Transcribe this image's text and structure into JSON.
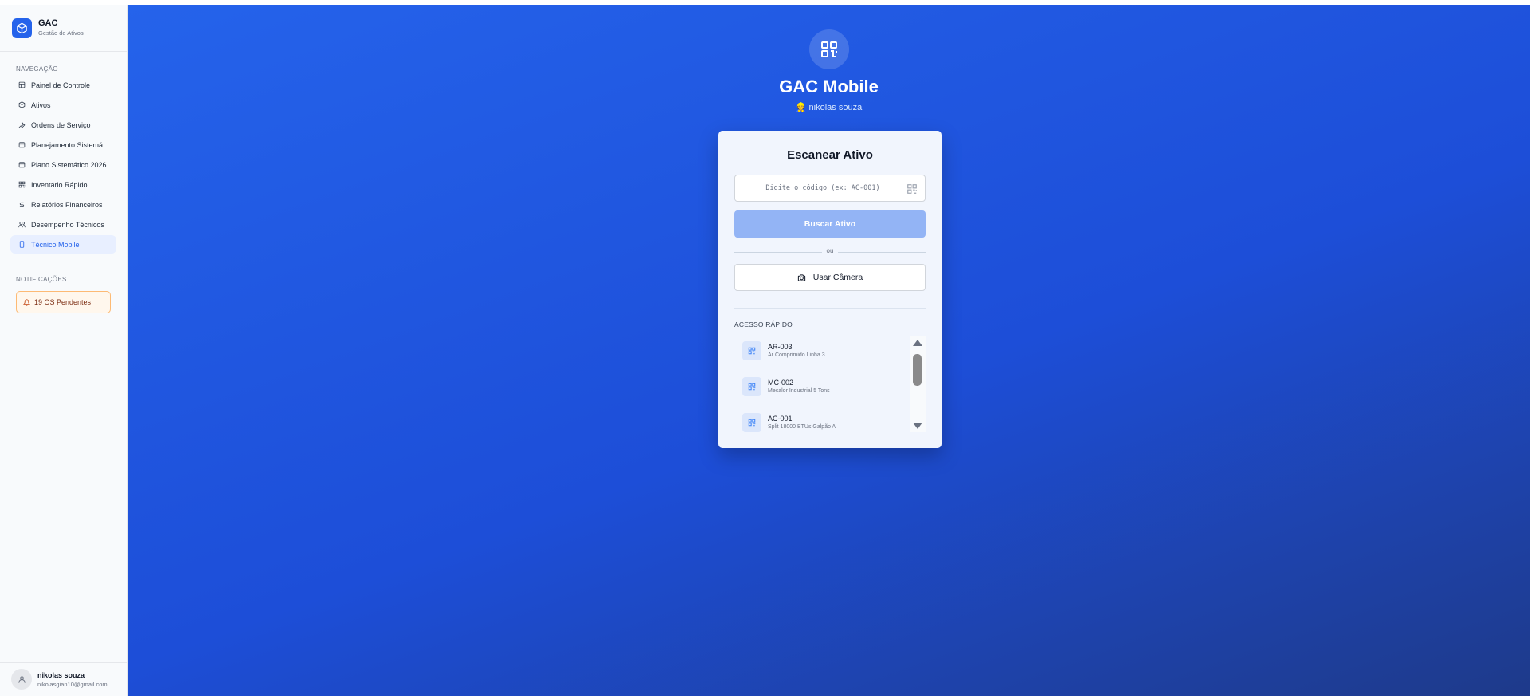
{
  "brand": {
    "title": "GAC",
    "subtitle": "Gestão de Ativos",
    "icon": "box-icon"
  },
  "sidebar": {
    "nav_label": "NAVEGAÇÃO",
    "items": [
      {
        "label": "Painel de Controle",
        "icon": "dashboard-icon"
      },
      {
        "label": "Ativos",
        "icon": "box-icon"
      },
      {
        "label": "Ordens de Serviço",
        "icon": "wrench-icon"
      },
      {
        "label": "Planejamento Sistemá...",
        "icon": "calendar-icon"
      },
      {
        "label": "Plano Sistemático 2026",
        "icon": "calendar-icon"
      },
      {
        "label": "Inventário Rápido",
        "icon": "qr-code-icon"
      },
      {
        "label": "Relatórios Financeiros",
        "icon": "dollar-icon"
      },
      {
        "label": "Desempenho Técnicos",
        "icon": "users-icon"
      },
      {
        "label": "Técnico Mobile",
        "icon": "smartphone-icon",
        "active": true
      }
    ],
    "notif_label": "NOTIFICAÇÕES",
    "notif_text": "19 OS Pendentes"
  },
  "user": {
    "name": "nikolas souza",
    "email": "nikolasgian10@gmail.com"
  },
  "hero": {
    "title": "GAC Mobile",
    "user": "👷 nikolas souza"
  },
  "scan": {
    "title": "Escanear Ativo",
    "input_placeholder": "Digite o código (ex: AC-001)",
    "input_value": "",
    "search_label": "Buscar Ativo",
    "or_label": "ou",
    "camera_label": "Usar Câmera"
  },
  "quick": {
    "label": "ACESSO RÁPIDO",
    "items": [
      {
        "code": "AR-003",
        "desc": "Ar Comprimido Linha 3"
      },
      {
        "code": "MC-002",
        "desc": "Mecalor Industrial 5 Tons"
      },
      {
        "code": "AC-001",
        "desc": "Split 18000 BTUs Galpão A"
      }
    ]
  },
  "colors": {
    "accent": "#2563eb",
    "button_disabled": "#93b4f5",
    "notif_border": "#fdba74"
  }
}
